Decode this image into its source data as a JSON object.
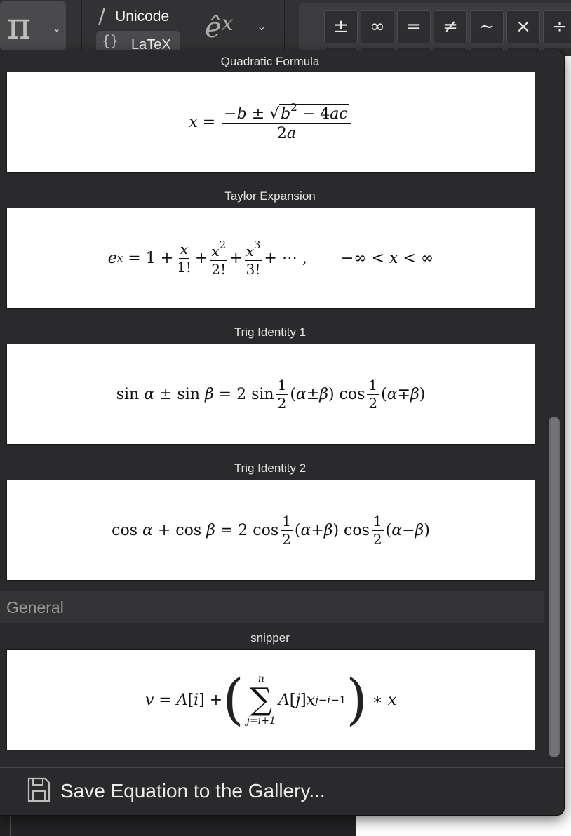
{
  "toolbar": {
    "eq_menu_icon": "pi-icon",
    "input_modes": {
      "unicode_label": "Unicode",
      "latex_label": "LaTeX"
    },
    "style_icon": "ex-hat-icon",
    "symbols": [
      "±",
      "∞",
      "=",
      "≠",
      "~",
      "×",
      "÷"
    ]
  },
  "gallery": {
    "items_top": [
      {
        "name": "Quadratic Formula"
      },
      {
        "name": "Taylor Expansion"
      },
      {
        "name": "Trig Identity 1"
      },
      {
        "name": "Trig Identity 2"
      }
    ],
    "section_general": "General",
    "items_general": [
      {
        "name": "snipper"
      }
    ]
  },
  "footer": {
    "save_label": "Save Equation to the Gallery...",
    "save_icon": "floppy-disk-icon"
  }
}
